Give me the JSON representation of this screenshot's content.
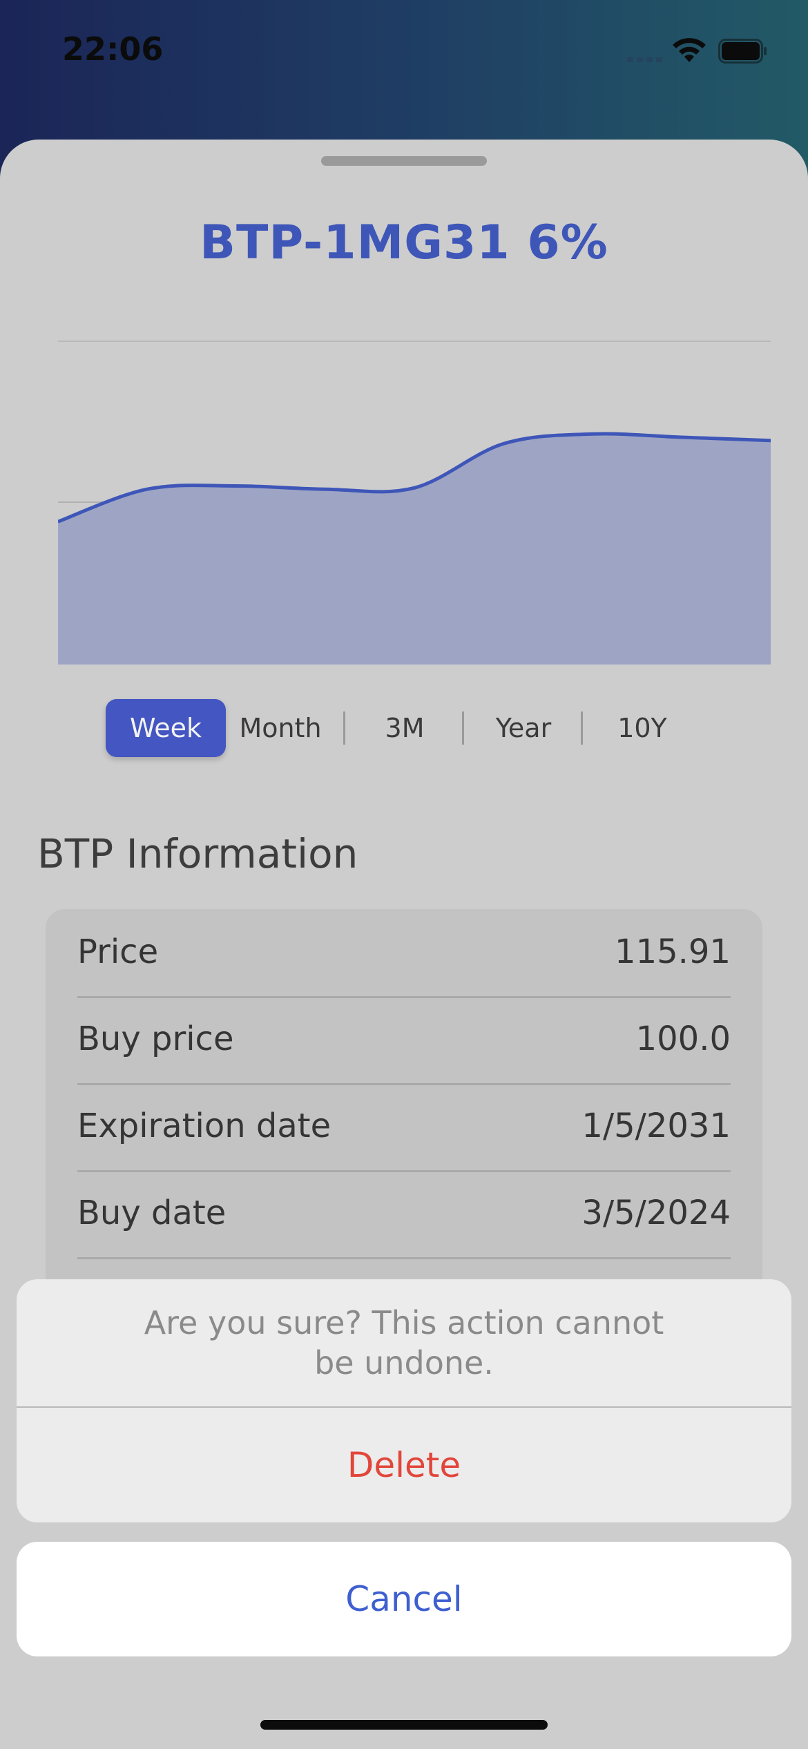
{
  "status_bar": {
    "time": "22:06"
  },
  "sheet": {
    "title": "BTP-1MG31 6%"
  },
  "chart_data": {
    "type": "area",
    "series": [
      {
        "values": [
          115.2,
          115.7,
          115.75,
          115.7,
          115.72,
          116.4,
          116.55,
          116.5,
          116.45
        ]
      }
    ],
    "ylim": [
      113,
      118
    ],
    "grid": true,
    "color": "#3e56b8"
  },
  "range_tabs": [
    {
      "label": "Week",
      "active": true
    },
    {
      "label": "Month",
      "active": false
    },
    {
      "label": "3M",
      "active": false
    },
    {
      "label": "Year",
      "active": false
    },
    {
      "label": "10Y",
      "active": false
    }
  ],
  "info": {
    "title": "BTP Information",
    "rows": [
      {
        "label": "Price",
        "value": "115.91"
      },
      {
        "label": "Buy price",
        "value": "100.0"
      },
      {
        "label": "Expiration date",
        "value": "1/5/2031"
      },
      {
        "label": "Buy date",
        "value": "3/5/2024"
      }
    ]
  },
  "action_sheet": {
    "message": "Are you sure? This action cannot be undone.",
    "delete_label": "Delete",
    "cancel_label": "Cancel"
  },
  "colors": {
    "accent": "#3e56b8",
    "destructive": "#e2463b",
    "cancel": "#3e5fd0"
  }
}
